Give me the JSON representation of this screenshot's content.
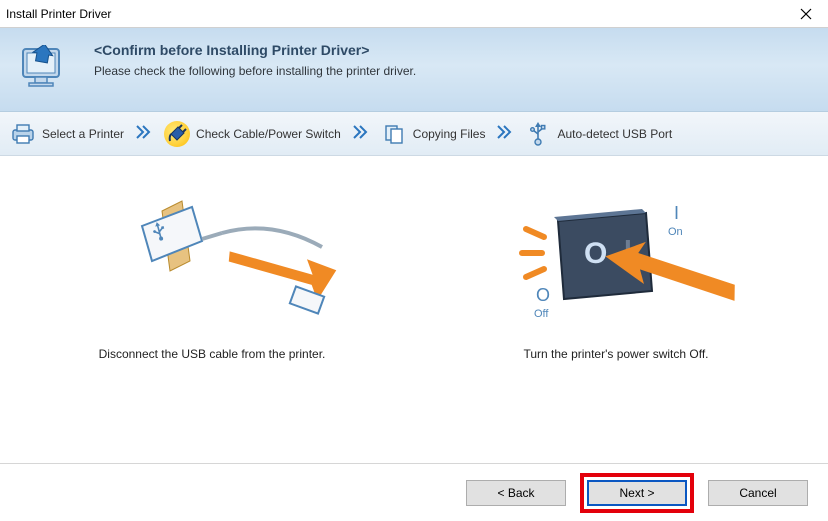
{
  "window": {
    "title": "Install Printer Driver"
  },
  "header": {
    "title": "<Confirm before Installing Printer Driver>",
    "subtitle": "Please check the following before installing the printer driver."
  },
  "steps": {
    "s1": "Select a Printer",
    "s2": "Check Cable/Power Switch",
    "s3": "Copying Files",
    "s4": "Auto-detect USB Port"
  },
  "panels": {
    "left_caption": "Disconnect the USB cable from the printer.",
    "right_caption": "Turn the printer's power switch Off.",
    "right_o_label": "O",
    "right_off_label": "Off",
    "right_i_label": "I",
    "right_on_label": "On"
  },
  "buttons": {
    "back": "< Back",
    "next": "Next >",
    "cancel": "Cancel"
  }
}
